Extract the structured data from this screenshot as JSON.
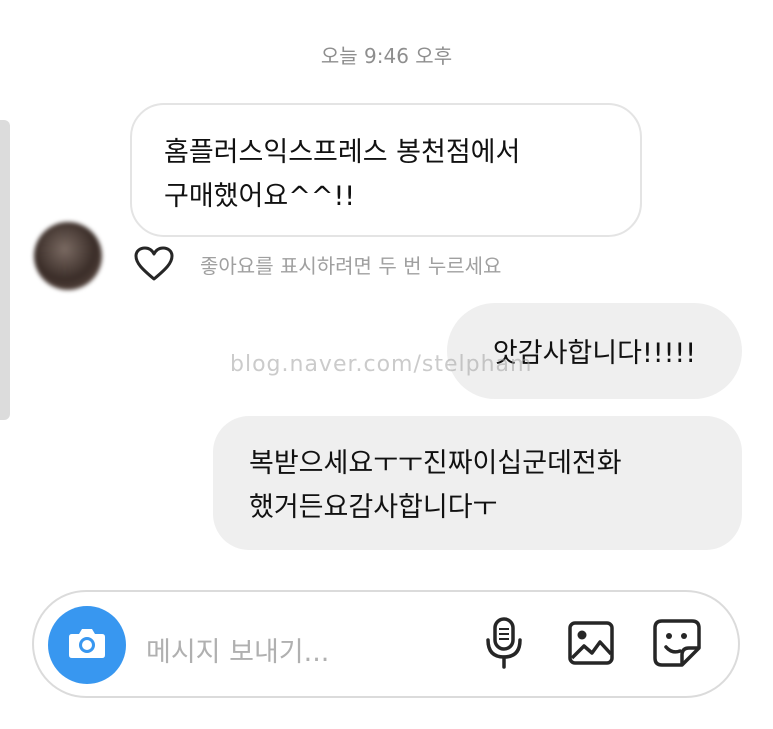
{
  "timestamp": "오늘 9:46 오후",
  "messages": {
    "incoming": {
      "line1": "홈플러스익스프레스 봉천점에서",
      "line2": "구매했어요^^!!"
    },
    "like_hint": "좋아요를 표시하려면 두 번 누르세요",
    "outgoing1": "앗감사합니다!!!!!",
    "outgoing2": {
      "line1": "복받으세요ㅜㅜ진짜이십군데전화",
      "line2": "했거든요감사합니다ㅜ"
    }
  },
  "watermark": "blog.naver.com/stelpham",
  "composer": {
    "placeholder": "메시지 보내기...",
    "icons": [
      "camera-icon",
      "microphone-icon",
      "gallery-icon",
      "sticker-icon"
    ],
    "accent_color": "#3897f0"
  }
}
